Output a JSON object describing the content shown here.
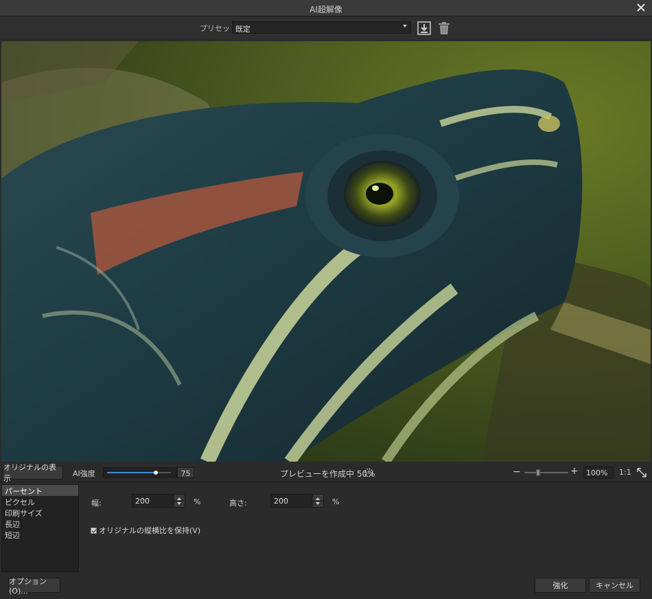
{
  "window": {
    "title": "AI超解像",
    "close_icon": "close-icon"
  },
  "preset": {
    "label": "プリセット",
    "selected": "既定",
    "save_icon": "download-save-icon",
    "delete_icon": "trash-icon"
  },
  "preview": {
    "image_desc": "turtle-close-up"
  },
  "controls": {
    "show_original_label": "オリジナルの表示",
    "ai_strength_label": "AI強度",
    "ai_strength_value": "75",
    "ai_strength_fraction": 0.75,
    "preview_status": "プレビューを作成中 50%",
    "zoom_value": "100%",
    "zoom_one_to_one": "1:1",
    "zoom_fraction": 0.3
  },
  "units": {
    "items": [
      {
        "label": "パーセント",
        "selected": true
      },
      {
        "label": "ピクセル",
        "selected": false
      },
      {
        "label": "印刷サイズ",
        "selected": false
      },
      {
        "label": "長辺",
        "selected": false
      },
      {
        "label": "短辺",
        "selected": false
      }
    ]
  },
  "settings": {
    "width_label": "幅:",
    "width_value": "200",
    "width_unit": "%",
    "height_label": "高さ:",
    "height_value": "200",
    "height_unit": "%",
    "keep_aspect_label": "オリジナルの縦横比を保持(V)",
    "keep_aspect_checked": true
  },
  "footer": {
    "options_label": "オプション(O)...",
    "apply_label": "強化",
    "cancel_label": "キャンセル"
  },
  "colors": {
    "accent": "#3d8ed6",
    "background": "#2b2b2b"
  }
}
